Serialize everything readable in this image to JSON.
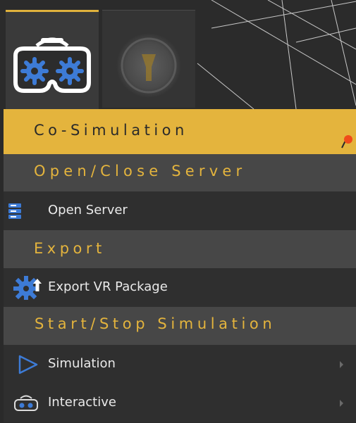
{
  "menu": {
    "title": "Co-Simulation",
    "sections": {
      "server": "Open/Close Server",
      "export": "Export",
      "simulation": "Start/Stop Simulation"
    },
    "items": {
      "open_server": "Open Server",
      "export_vr": "Export VR Package",
      "simulation": "Simulation",
      "interactive": "Interactive"
    }
  },
  "colors": {
    "accent": "#e4b43d",
    "section_bg": "#474747",
    "item_bg": "#2f2f2f",
    "icon_blue": "#3d7bd6"
  },
  "icons": {
    "tab_vr": "vr-headset-gears-icon",
    "tab_logo": "blurred-logo-icon",
    "title_pin": "map-pin-icon",
    "open_server": "server-icon",
    "export_vr": "gear-upload-icon",
    "simulation": "play-triangle-icon",
    "interactive": "vr-headset-icon",
    "submenu": "chevron-right-icon"
  }
}
